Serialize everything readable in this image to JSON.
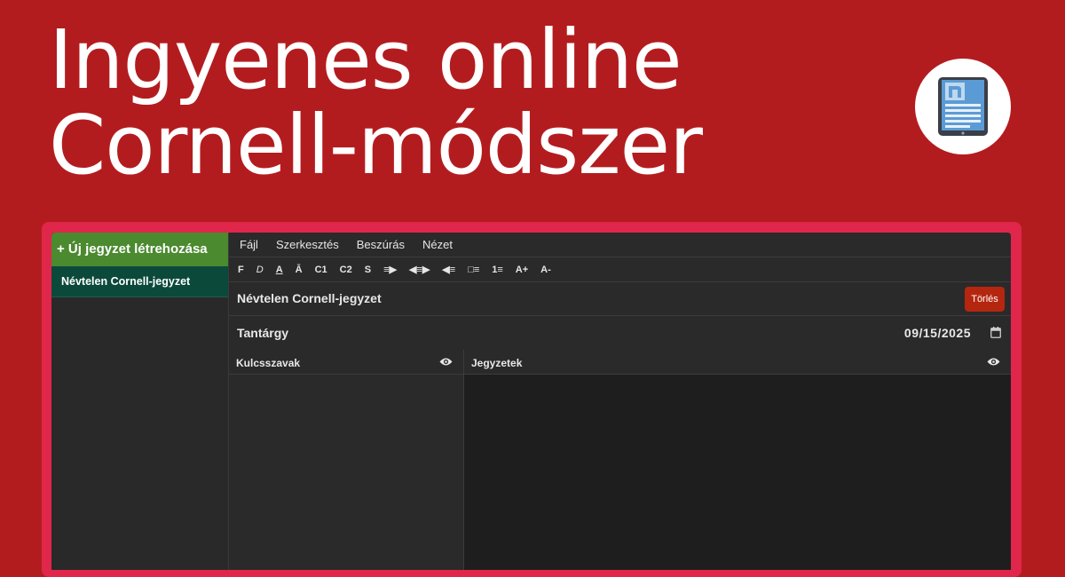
{
  "hero": {
    "line1": "Ingyenes online",
    "line2": "Cornell-módszer"
  },
  "logo": {
    "icon": "ebook-tablet-icon",
    "colors": {
      "screen": "#5b9bd5",
      "frame": "#3a3f47"
    }
  },
  "sidebar": {
    "new_note_label": "+ Új jegyzet létrehozása",
    "notes": [
      {
        "label": "Névtelen Cornell-jegyzet"
      }
    ]
  },
  "menu": {
    "items": [
      "Fájl",
      "Szerkesztés",
      "Beszúrás",
      "Nézet"
    ]
  },
  "toolbar": {
    "buttons": [
      {
        "label": "F",
        "icon": "bold"
      },
      {
        "label": "D",
        "icon": "italic"
      },
      {
        "label": "A",
        "icon": "underline"
      },
      {
        "label": "Ā",
        "icon": "strikethrough"
      },
      {
        "label": "C1",
        "icon": "heading-1"
      },
      {
        "label": "C2",
        "icon": "heading-2"
      },
      {
        "label": "S",
        "icon": "paragraph"
      },
      {
        "label": "≡▶",
        "icon": "indent"
      },
      {
        "label": "◀≡▶",
        "icon": "center"
      },
      {
        "label": "◀≡",
        "icon": "outdent"
      },
      {
        "label": "□≡",
        "icon": "bullet-list"
      },
      {
        "label": "1≡",
        "icon": "numbered-list"
      },
      {
        "label": "A+",
        "icon": "font-increase"
      },
      {
        "label": "A-",
        "icon": "font-decrease"
      }
    ]
  },
  "note": {
    "title": "Névtelen Cornell-jegyzet",
    "delete_label": "Törlés",
    "subject_label": "Tantárgy",
    "date": "09/15/2025"
  },
  "columns": {
    "keywords_label": "Kulcsszavak",
    "notes_label": "Jegyzetek"
  },
  "colors": {
    "background": "#b31c1f",
    "frame": "#e0264a",
    "new_note_button": "#4b8a2f",
    "active_note": "#0b4a3b",
    "delete_button": "#b5260f"
  }
}
